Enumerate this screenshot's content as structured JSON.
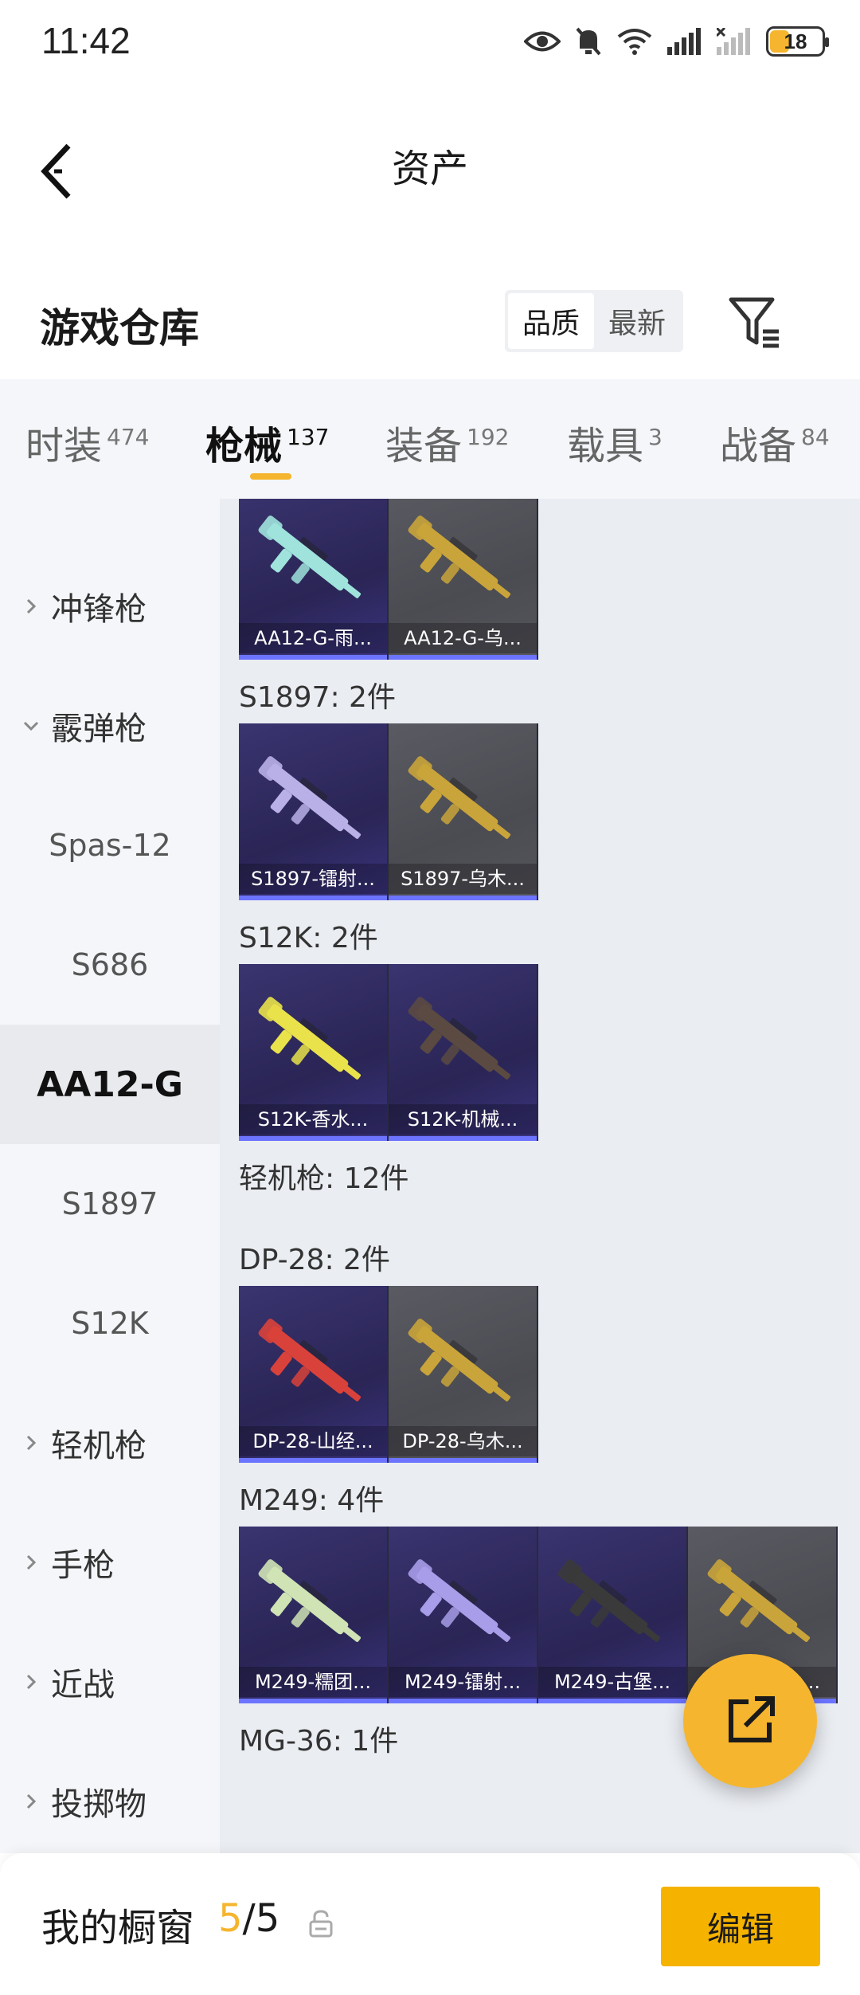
{
  "status_bar": {
    "time": "11:42",
    "battery": "18"
  },
  "nav": {
    "title": "资产"
  },
  "header": {
    "title": "游戏仓库",
    "sort_options": [
      {
        "label": "品质",
        "active": true
      },
      {
        "label": "最新",
        "active": false
      }
    ]
  },
  "tabs": [
    {
      "label": "时装",
      "count": "474"
    },
    {
      "label": "枪械",
      "count": "137",
      "active": true
    },
    {
      "label": "装备",
      "count": "192"
    },
    {
      "label": "载具",
      "count": "3"
    },
    {
      "label": "战备",
      "count": "84"
    }
  ],
  "sidebar": [
    {
      "label": "冲锋枪",
      "type": "collapsed"
    },
    {
      "label": "霰弹枪",
      "type": "expanded"
    },
    {
      "label": "Spas-12",
      "type": "sub"
    },
    {
      "label": "S686",
      "type": "sub"
    },
    {
      "label": "AA12-G",
      "type": "sub",
      "active": true
    },
    {
      "label": "S1897",
      "type": "sub"
    },
    {
      "label": "S12K",
      "type": "sub"
    },
    {
      "label": "轻机枪",
      "type": "collapsed"
    },
    {
      "label": "手枪",
      "type": "collapsed"
    },
    {
      "label": "近战",
      "type": "collapsed"
    },
    {
      "label": "投掷物",
      "type": "collapsed"
    }
  ],
  "content": {
    "groups": [
      {
        "label": "",
        "items": [
          {
            "name": "AA12-G-雨...",
            "bg": "purple",
            "color": "#9fe3dc"
          },
          {
            "name": "AA12-G-乌...",
            "bg": "gray",
            "color": "#c9a43a"
          }
        ]
      },
      {
        "label": "S1897: 2件",
        "items": [
          {
            "name": "S1897-镭射...",
            "bg": "purple",
            "color": "#b9b0e8"
          },
          {
            "name": "S1897-乌木...",
            "bg": "gray",
            "color": "#c9a43a"
          }
        ]
      },
      {
        "label": "S12K: 2件",
        "items": [
          {
            "name": "S12K-香水...",
            "bg": "purple",
            "color": "#e9e24a"
          },
          {
            "name": "S12K-机械...",
            "bg": "purple",
            "color": "#5a4a42"
          }
        ]
      },
      {
        "label": "轻机枪: 12件",
        "items": []
      },
      {
        "label": "DP-28: 2件",
        "items": [
          {
            "name": "DP-28-山经...",
            "bg": "purple",
            "color": "#d9423a"
          },
          {
            "name": "DP-28-乌木...",
            "bg": "gray",
            "color": "#c9a43a"
          }
        ]
      },
      {
        "label": "M249: 4件",
        "items": [
          {
            "name": "M249-糯团...",
            "bg": "purple",
            "color": "#cfe3b5"
          },
          {
            "name": "M249-镭射...",
            "bg": "purple",
            "color": "#a79de8"
          },
          {
            "name": "M249-古堡...",
            "bg": "purple",
            "color": "#3a3a3a"
          },
          {
            "name": "M249-乌木...",
            "bg": "gray",
            "color": "#c9a43a"
          }
        ]
      },
      {
        "label": "MG-36: 1件",
        "items": []
      }
    ]
  },
  "bottom_bar": {
    "label": "我的橱窗",
    "count_current": "5",
    "count_total": "5",
    "edit_label": "编辑"
  },
  "colors": {
    "accent": "#f5b52e",
    "card_purple": "#2f2a5c",
    "card_gray": "#505058"
  }
}
